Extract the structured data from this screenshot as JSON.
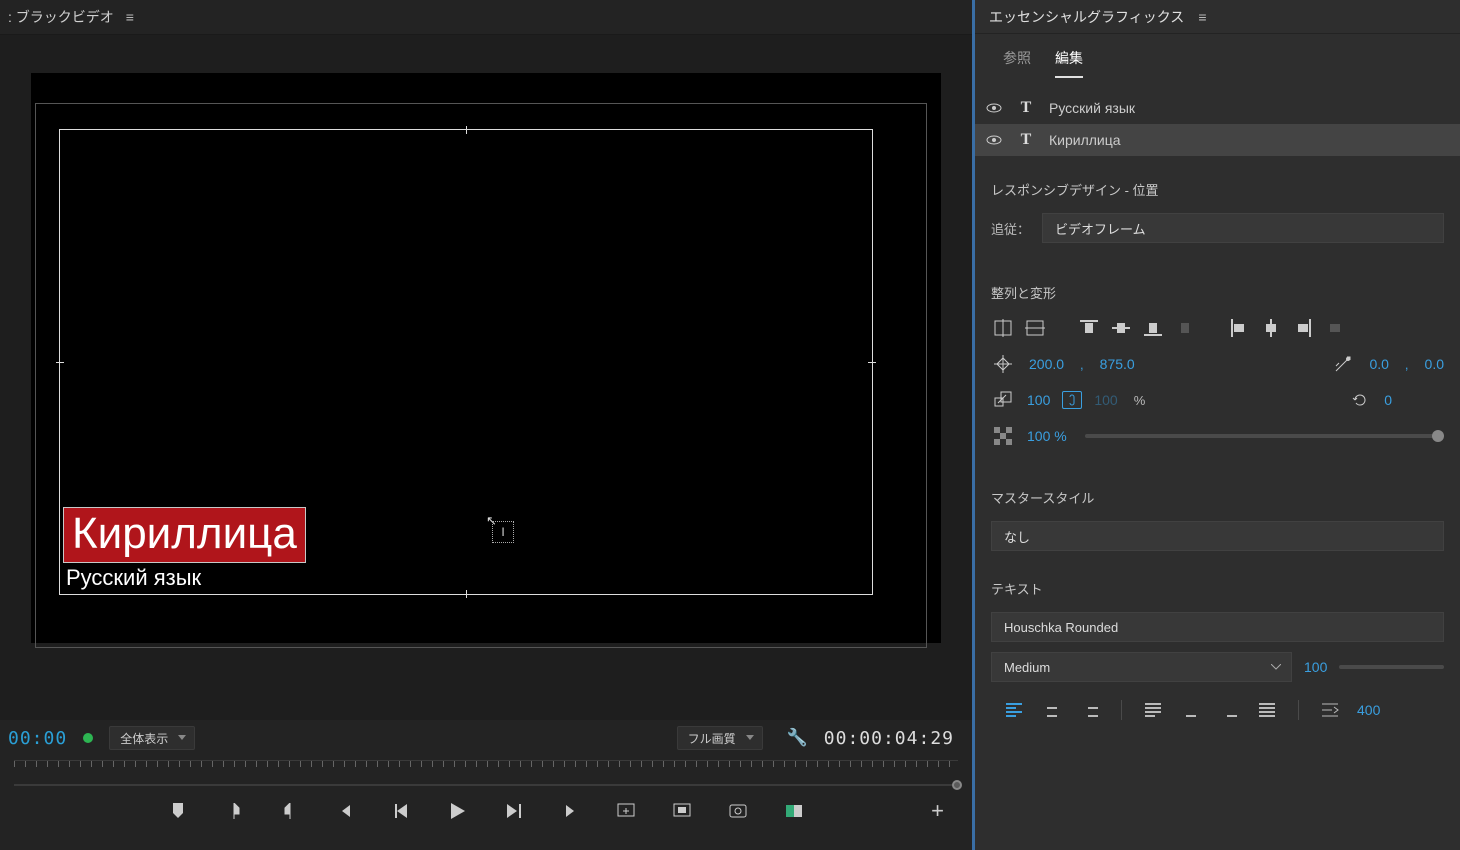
{
  "titlebar": {
    "label": ": ブラックビデオ"
  },
  "viewer": {
    "title_text": "Кириллица",
    "subtitle_text": "Русский язык"
  },
  "controls": {
    "tc_left": "00:00",
    "fit_label": "全体表示",
    "quality_label": "フル画質",
    "tc_right": "00:00:04:29"
  },
  "panel": {
    "title": "エッセンシャルグラフィックス",
    "tabs": {
      "browse": "参照",
      "edit": "編集"
    },
    "layers": [
      {
        "name": "Русский язык"
      },
      {
        "name": "Кириллица"
      }
    ],
    "responsive": {
      "heading": "レスポンシブデザイン  - 位置",
      "follow_label": "追従：",
      "follow_value": "ビデオフレーム"
    },
    "align": {
      "heading": "整列と変形",
      "pos_x": "200.0",
      "pos_y": "875.0",
      "anchor_x": "0.0",
      "anchor_y": "0.0",
      "scale_w": "100",
      "scale_h": "100",
      "pct": "%",
      "rotation": "0",
      "opacity": "100 %"
    },
    "master": {
      "heading": "マスタースタイル",
      "value": "なし"
    },
    "text": {
      "heading": "テキスト",
      "font": "Houschka Rounded",
      "weight": "Medium",
      "size": "100",
      "leading": "400"
    }
  }
}
